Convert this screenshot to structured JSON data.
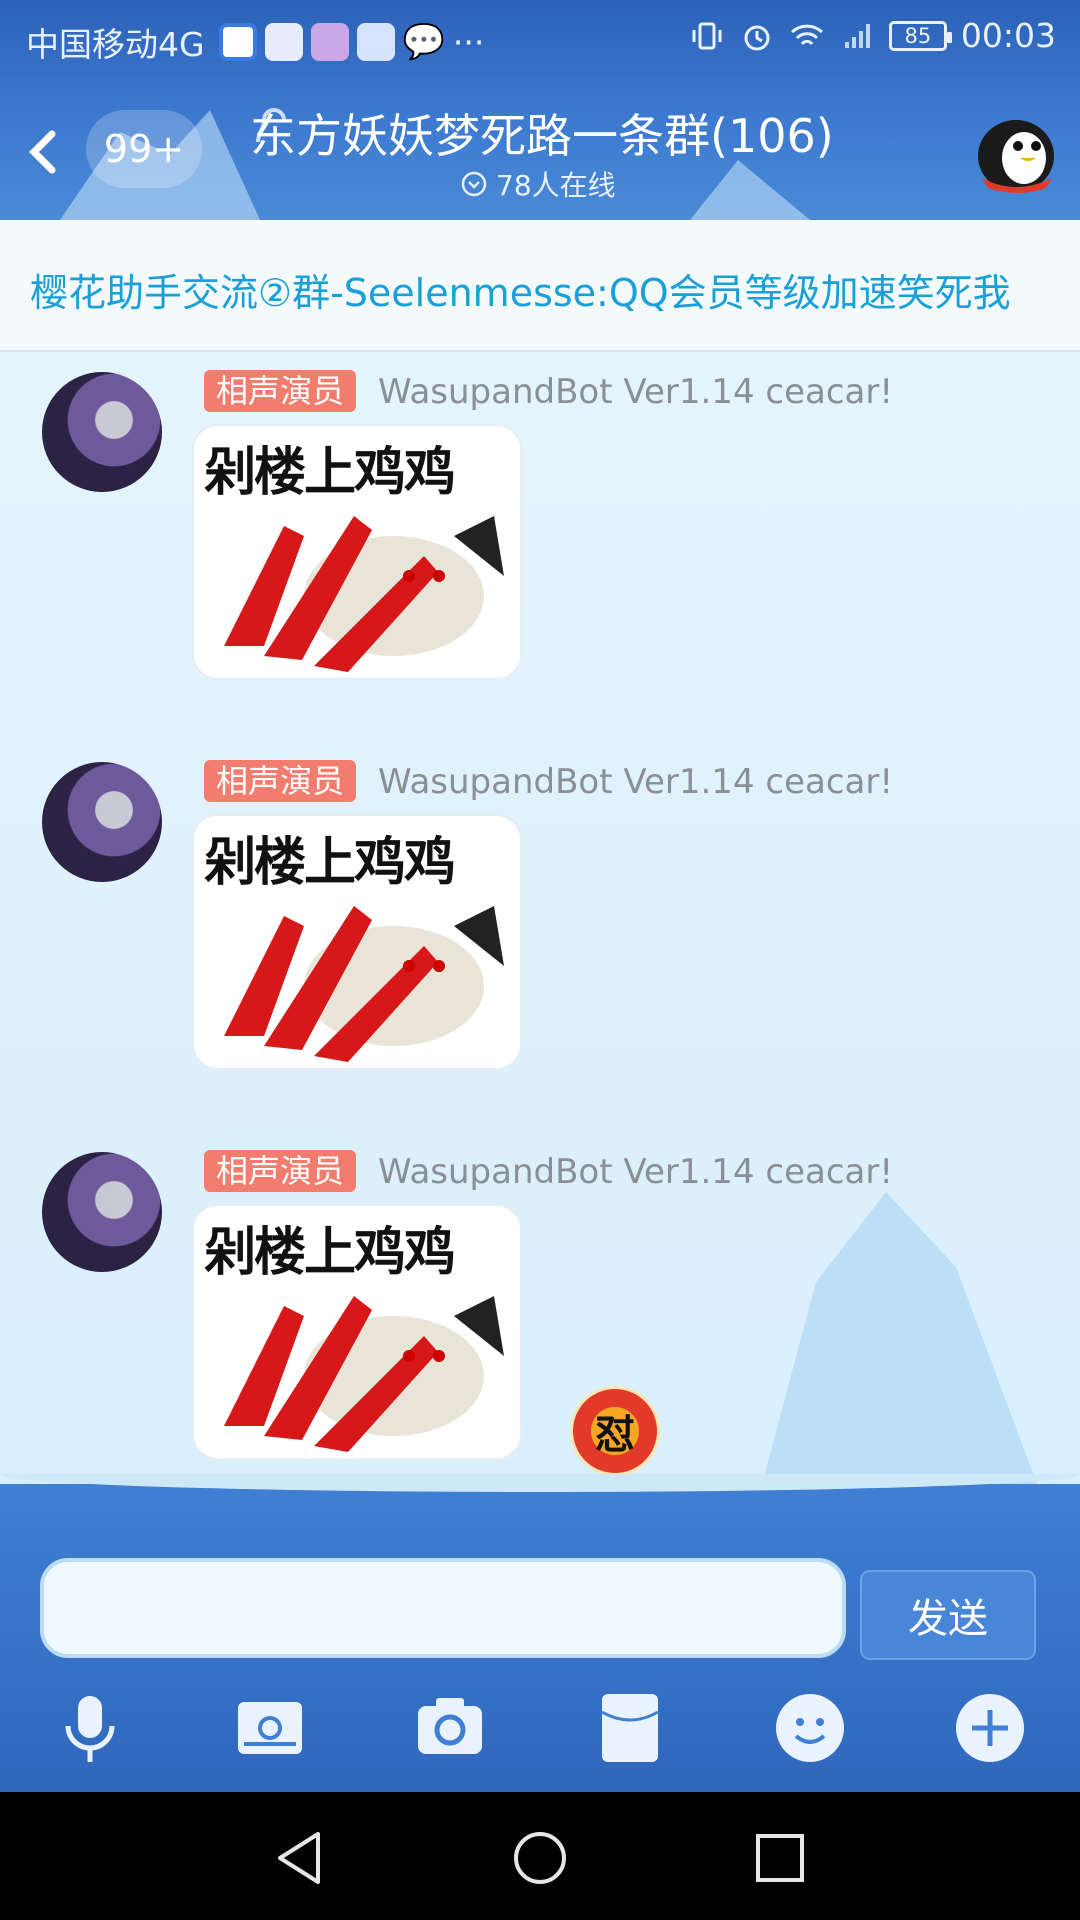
{
  "status_bar": {
    "carrier": "中国移动4G",
    "more": "···",
    "battery": "85",
    "time": "00:03"
  },
  "header": {
    "unread_badge": "99+",
    "title": "东方妖妖梦死路一条群(106)",
    "online": "78人在线"
  },
  "notice": {
    "text": "樱花助手交流②群-Seelenmesse:QQ会员等级加速笑死我"
  },
  "messages": [
    {
      "title_tag": "相声演员",
      "sender": "WasupandBot Ver1.14 ceacar!",
      "sticker_caption": "剁楼上鸡鸡"
    },
    {
      "title_tag": "相声演员",
      "sender": "WasupandBot Ver1.14 ceacar!",
      "sticker_caption": "剁楼上鸡鸡"
    },
    {
      "title_tag": "相声演员",
      "sender": "WasupandBot Ver1.14 ceacar!",
      "sticker_caption": "剁楼上鸡鸡"
    }
  ],
  "float_badge": "怼",
  "input": {
    "value": "",
    "send_label": "发送"
  },
  "toolbar": [
    "microphone-icon",
    "image-icon",
    "camera-icon",
    "red-packet-icon",
    "emoji-icon",
    "plus-icon"
  ],
  "colors": {
    "header_blue": "#2c62b8",
    "notice_text": "#1aa0d8",
    "title_tag": "#f27d6e",
    "send_button": "#4a86d8"
  }
}
